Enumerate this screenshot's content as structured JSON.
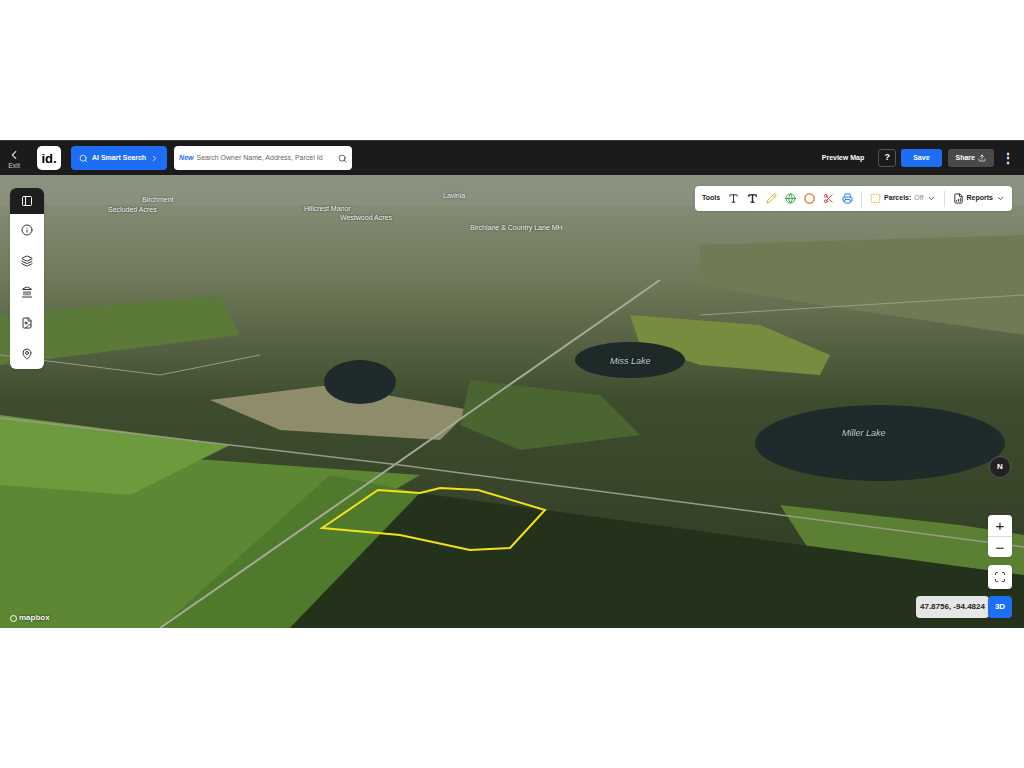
{
  "header": {
    "exit_label": "Exit",
    "logo": "id.",
    "ai_button": "AI Smart Search",
    "search": {
      "badge": "New",
      "placeholder": "Search Owner Name, Address, Parcel Id"
    },
    "preview": "Preview Map",
    "help": "?",
    "save": "Save",
    "share": "Share",
    "menu": "⋮"
  },
  "toolbar": {
    "label": "Tools",
    "parcels": "Parcels:",
    "parcels_state": "Off",
    "reports": "Reports"
  },
  "map_labels": [
    {
      "text": "Birchment",
      "kind": "place"
    },
    {
      "text": "Secluded Acres",
      "kind": "place"
    },
    {
      "text": "Hillcrest Manor",
      "kind": "place"
    },
    {
      "text": "Westwood Acres",
      "kind": "place"
    },
    {
      "text": "Lavinia",
      "kind": "place"
    },
    {
      "text": "Birchlane & Country Lane MH",
      "kind": "place"
    },
    {
      "text": "Miss Lake",
      "kind": "water"
    },
    {
      "text": "Miller Lake",
      "kind": "water"
    }
  ],
  "compass": "N",
  "zoom": {
    "in": "+",
    "out": "−"
  },
  "coordinates": "47.8756, -94.4824",
  "view_mode": "3D",
  "attribution": "mapbox"
}
